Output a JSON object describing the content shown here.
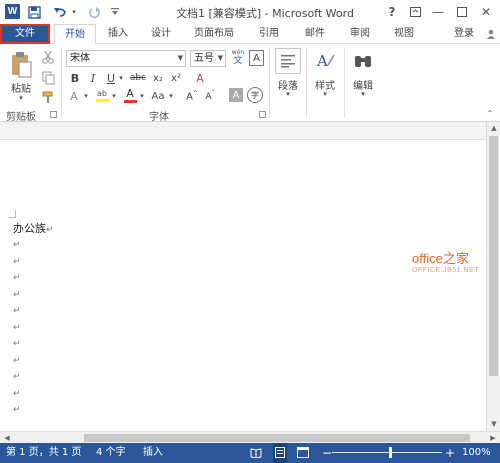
{
  "titlebar": {
    "app_icon_letter": "W",
    "title": "文档1 [兼容模式] - Microsoft Word",
    "help": "?",
    "minimize": "—",
    "close": "✕"
  },
  "tabs": {
    "file": "文件",
    "items": [
      "开始",
      "插入",
      "设计",
      "页面布局",
      "引用",
      "邮件",
      "审阅",
      "视图"
    ],
    "login": "登录"
  },
  "ribbon": {
    "clipboard": {
      "paste_label": "粘贴",
      "group_label": "剪贴板"
    },
    "font": {
      "font_name": "宋体",
      "font_size": "五号",
      "phonetic_top": "wén",
      "phonetic_char": "文",
      "border_char": "A",
      "bold": "B",
      "italic": "I",
      "underline": "U",
      "strike": "abc",
      "subscript": "x₂",
      "superscript": "x²",
      "clear": "A",
      "highlight": "ab",
      "font_color": "A",
      "case": "Aa",
      "grow": "A",
      "shrink": "A",
      "shade_char": "A",
      "circle_char": "字",
      "group_label": "字体"
    },
    "paragraph": {
      "label": "段落"
    },
    "styles": {
      "label": "样式"
    },
    "editing": {
      "label": "编辑"
    }
  },
  "document": {
    "first_line": "办公族",
    "para_mark": "↵",
    "empty_lines": 11
  },
  "watermark": {
    "main": "office之家",
    "sub": "OFFICE.JB51.NET"
  },
  "status": {
    "page": "第 1 页，共 1 页",
    "words": "4 个字",
    "mode": "插入",
    "zoom": "100%",
    "zoom_minus": "−",
    "zoom_plus": "+"
  },
  "colors": {
    "accent": "#2b579a",
    "file_border": "#e0342b",
    "highlight": "#ffff00",
    "font_color": "#e0342b",
    "watermark": "#e8622a"
  }
}
